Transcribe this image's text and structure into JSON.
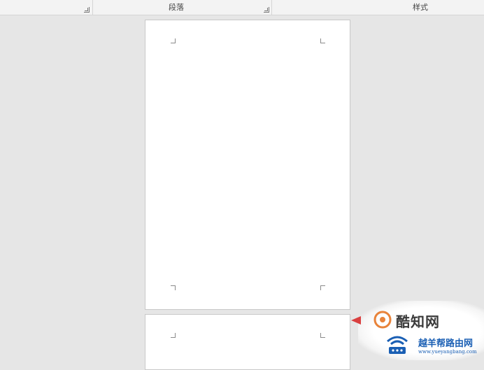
{
  "ribbon": {
    "groups": [
      {
        "label": ""
      },
      {
        "label": "段落"
      },
      {
        "label": "样式"
      }
    ]
  },
  "watermarks": {
    "site1_name": "酷知网",
    "site2_name": "越羊帮路由网",
    "site2_url": "www.yueyangbang.com",
    "accent_orange": "#e8833a",
    "accent_blue": "#1a5fb4"
  }
}
